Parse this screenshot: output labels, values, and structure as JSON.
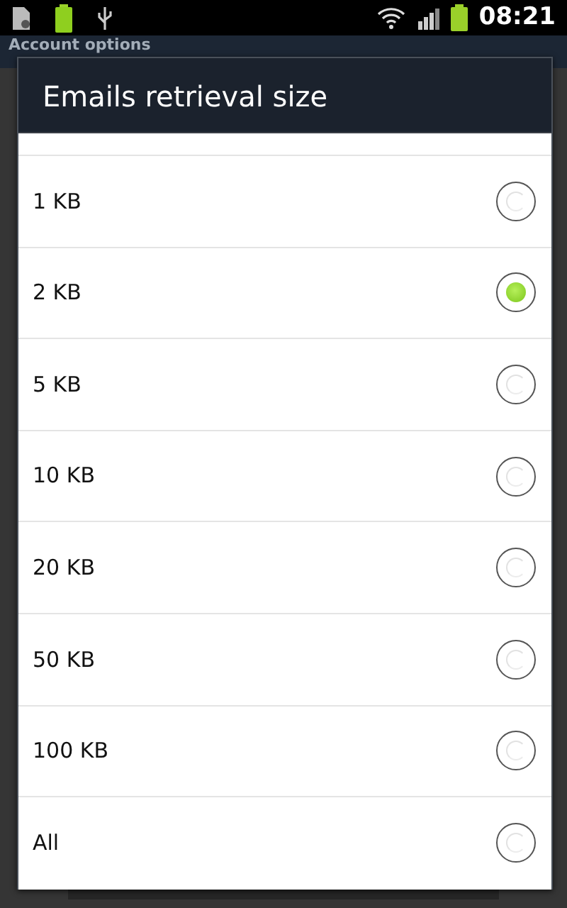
{
  "status_bar": {
    "time": "08:21"
  },
  "background_screen": {
    "title": "Account options"
  },
  "dialog": {
    "title": "Emails retrieval size",
    "options": [
      {
        "label": "1 KB",
        "selected": false
      },
      {
        "label": "2 KB",
        "selected": true
      },
      {
        "label": "5 KB",
        "selected": false
      },
      {
        "label": "10 KB",
        "selected": false
      },
      {
        "label": "20 KB",
        "selected": false
      },
      {
        "label": "50 KB",
        "selected": false
      },
      {
        "label": "100 KB",
        "selected": false
      },
      {
        "label": "All",
        "selected": false
      }
    ]
  }
}
